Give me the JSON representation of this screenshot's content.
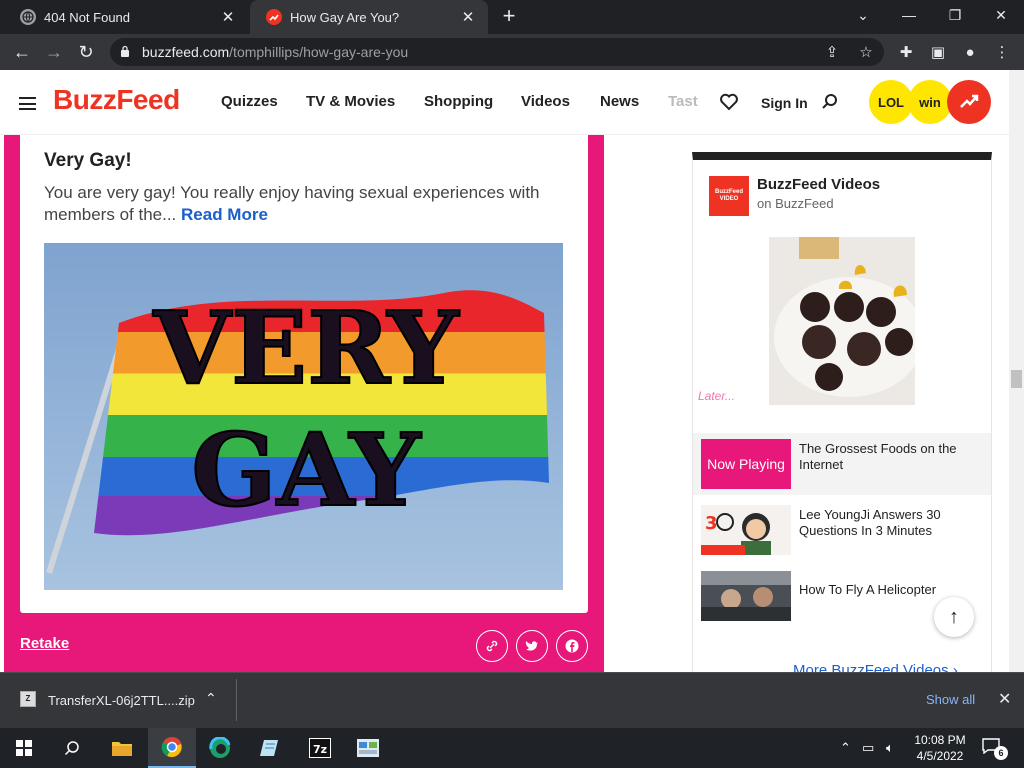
{
  "browser": {
    "tabs": [
      {
        "title": "404 Not Found",
        "active": false
      },
      {
        "title": "How Gay Are You?",
        "active": true
      }
    ],
    "url_host": "buzzfeed.com",
    "url_path": "/tomphillips/how-gay-are-you"
  },
  "header": {
    "logo": "BuzzFeed",
    "nav": [
      "Quizzes",
      "TV & Movies",
      "Shopping",
      "Videos",
      "News",
      "Tast"
    ],
    "sign_in": "Sign In",
    "badges": [
      "LOL",
      "win"
    ]
  },
  "result": {
    "title": "Very Gay!",
    "description": "You are very gay! You really enjoy having sexual experiences with members of the...",
    "read_more": "Read More",
    "image_text_line1": "VERY",
    "image_text_line2": "GAY",
    "retake": "Retake"
  },
  "sidebar": {
    "channel": "BuzzFeed Videos",
    "source": "on BuzzFeed",
    "logo_text": "BuzzFeed VIDEO",
    "later": "Later...",
    "now_playing_label": "Now Playing",
    "videos": [
      {
        "title": "The Grossest Foods on the Internet"
      },
      {
        "title": "Lee YoungJi Answers 30 Questions In 3 Minutes"
      },
      {
        "title": "How To Fly A Helicopter"
      }
    ],
    "more": "More BuzzFeed Videos"
  },
  "downloads": {
    "file": "TransferXL-06j2TTL....zip",
    "show_all": "Show all"
  },
  "taskbar": {
    "time": "10:08 PM",
    "date": "4/5/2022",
    "notifications": "6"
  }
}
